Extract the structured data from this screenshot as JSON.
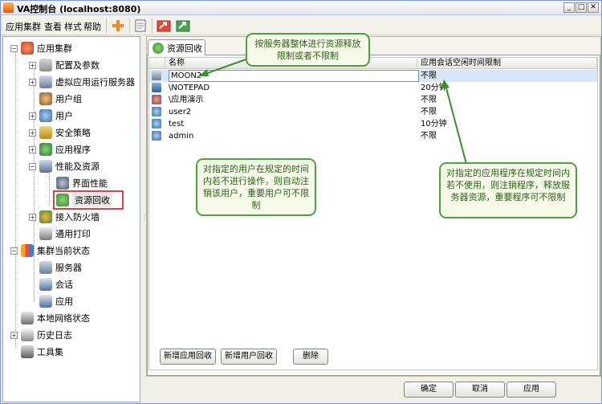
{
  "window": {
    "title": "VA控制台 (localhost:8080)",
    "minimize": "_",
    "maximize": "□",
    "close": "✕"
  },
  "menubar": {
    "items": [
      "应用集群",
      "查看",
      "样式",
      "帮助"
    ]
  },
  "toolbar": [
    "add-icon",
    "document-icon",
    "export-icon",
    "refresh-icon"
  ],
  "tree": {
    "root": "应用集群",
    "items": [
      {
        "label": "配置及参数"
      },
      {
        "label": "虚拟应用运行服务器"
      },
      {
        "label": "用户组"
      },
      {
        "label": "用户"
      },
      {
        "label": "安全策略"
      },
      {
        "label": "应用程序"
      },
      {
        "label": "性能及资源"
      },
      {
        "label": "界面性能"
      },
      {
        "label": "资源回收"
      },
      {
        "label": "接入防火墙"
      },
      {
        "label": "通用打印"
      },
      {
        "label": "集群当前状态"
      },
      {
        "label": "服务器"
      },
      {
        "label": "会话"
      },
      {
        "label": "应用"
      },
      {
        "label": "本地网络状态"
      },
      {
        "label": "历史日志"
      },
      {
        "label": "工具集"
      }
    ]
  },
  "tab": {
    "label": "资源回收"
  },
  "table": {
    "columns": [
      "名称",
      "应用会话空闲时间限制"
    ],
    "rows": [
      {
        "name": "MOON2",
        "limit": "不限",
        "icon": "server-icon"
      },
      {
        "name": "\\NOTEPAD",
        "limit": "20分钟",
        "icon": "app-icon"
      },
      {
        "name": "\\应用演示",
        "limit": "不限",
        "icon": "app-icon"
      },
      {
        "name": "user2",
        "limit": "不限",
        "icon": "user-icon"
      },
      {
        "name": "test",
        "limit": "10分钟",
        "icon": "user-icon"
      },
      {
        "name": "admin",
        "limit": "不限",
        "icon": "user-icon"
      }
    ]
  },
  "actions": {
    "add_app": "新增应用回收",
    "add_user": "新增用户回收",
    "delete": "删除"
  },
  "footer": {
    "ok": "确定",
    "cancel": "取消",
    "apply": "应用"
  },
  "callouts": {
    "server": "按服务器整体进行资源释放限制或者不限制",
    "user": "对指定的用户在规定的时间内若不进行操作，则自动注销该用户，重要用户可不限制",
    "app": "对指定的应用程序在规定时间内若不使用，则注销程序，释放服务器资源，重要程序可不限制"
  },
  "colors": {
    "accent": "#316ac5",
    "callout_border": "#4fa040",
    "highlight": "#d9414c"
  }
}
